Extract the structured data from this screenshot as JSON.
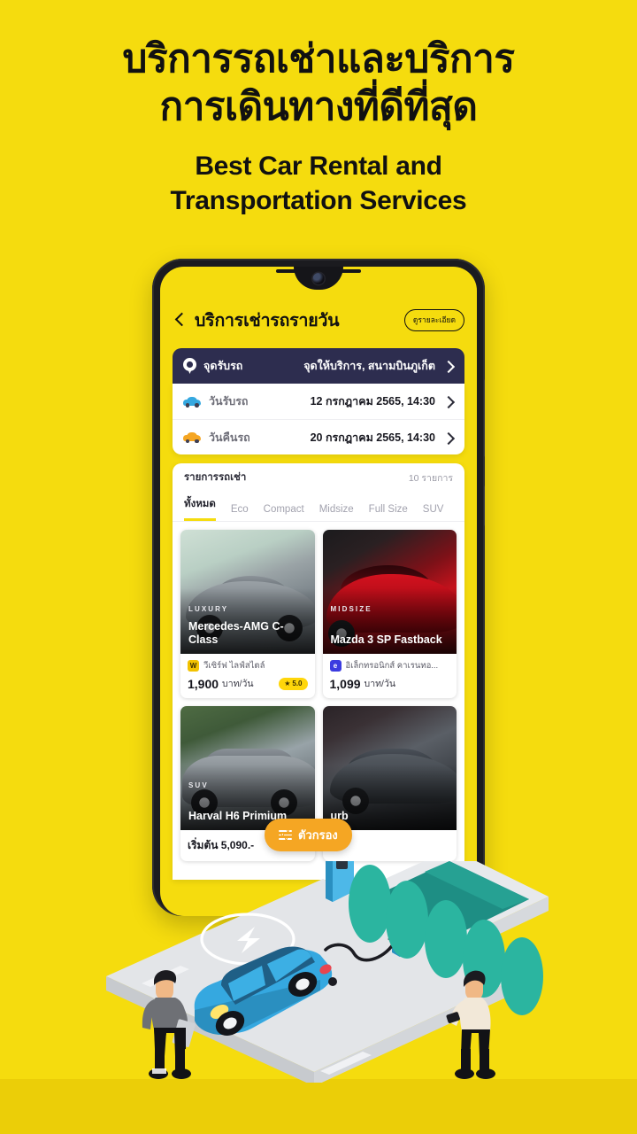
{
  "theme": {
    "background": "#F5DC0E",
    "background_band": "#EBCE08",
    "navy": "#2D2D4F",
    "accent_orange": "#F5A623",
    "star_yellow": "#FFD60A"
  },
  "headline": {
    "thai_line1": "บริการรถเช่าและบริการ",
    "thai_line2": "การเดินทางที่ดีที่สุด",
    "english_line1": "Best Car Rental and",
    "english_line2": "Transportation Services"
  },
  "phone": {
    "app_header": {
      "back_icon": "chevron-left-icon",
      "title": "บริการเช่ารถรายวัน",
      "detail_button": "ดูรายละเอียด"
    },
    "pickup_bar": {
      "icon": "map-pin-icon",
      "label": "จุดรับรถ",
      "value": "จุดให้บริการ, สนามบินภูเก็ต",
      "chevron": "chevron-right-icon"
    },
    "date_rows": [
      {
        "icon": "car-front-blue-icon",
        "label": "วันรับรถ",
        "value": "12 กรกฎาคม 2565, 14:30",
        "chevron": "chevron-right-icon"
      },
      {
        "icon": "car-front-orange-icon",
        "label": "วันคืนรถ",
        "value": "20 กรกฎาคม 2565, 14:30",
        "chevron": "chevron-right-icon"
      }
    ],
    "list": {
      "title": "รายการรถเช่า",
      "count": "10 รายการ",
      "tabs": [
        {
          "label": "ทั้งหมด",
          "active": true
        },
        {
          "label": "Eco",
          "active": false
        },
        {
          "label": "Compact",
          "active": false
        },
        {
          "label": "Midsize",
          "active": false
        },
        {
          "label": "Full Size",
          "active": false
        },
        {
          "label": "SUV",
          "active": false
        }
      ],
      "cards": [
        {
          "category": "LUXURY",
          "name": "Mercedes-AMG C-Class",
          "vendor": "วีเซิร์ฟ ไลฟ์สไตล์",
          "vendor_logo_letter": "W",
          "price": "1,900",
          "unit": "บาท/วัน",
          "rating": "5.0",
          "rating_icon": "star-icon"
        },
        {
          "category": "MIDSIZE",
          "name": "Mazda 3 SP Fastback",
          "vendor": "อิเล็กทรอนิกส์ คาเรนทอ...",
          "vendor_logo_letter": "e",
          "price": "1,099",
          "unit": "บาท/วัน",
          "rating": "",
          "rating_icon": ""
        },
        {
          "category": "SUV",
          "name": "Harval H6 Primium",
          "start_label": "เริ่มต้น 5,090.-"
        },
        {
          "category": "",
          "name": "urb",
          "start_label": ""
        }
      ]
    },
    "filter_fab": {
      "icon": "sliders-icon",
      "label": "ตัวกรอง"
    }
  },
  "illustration": {
    "name": "ev-charging-station-illustration",
    "charge_badge_icon": "lightning-bolt-icon",
    "car_color": "#35A8E0",
    "tree_color": "#2BB5A0",
    "pad_color": "#D9DBDE",
    "people": [
      {
        "name": "person-left",
        "shirt": "#6E7075"
      },
      {
        "name": "person-right",
        "shirt": "#F2E8D8"
      }
    ]
  }
}
